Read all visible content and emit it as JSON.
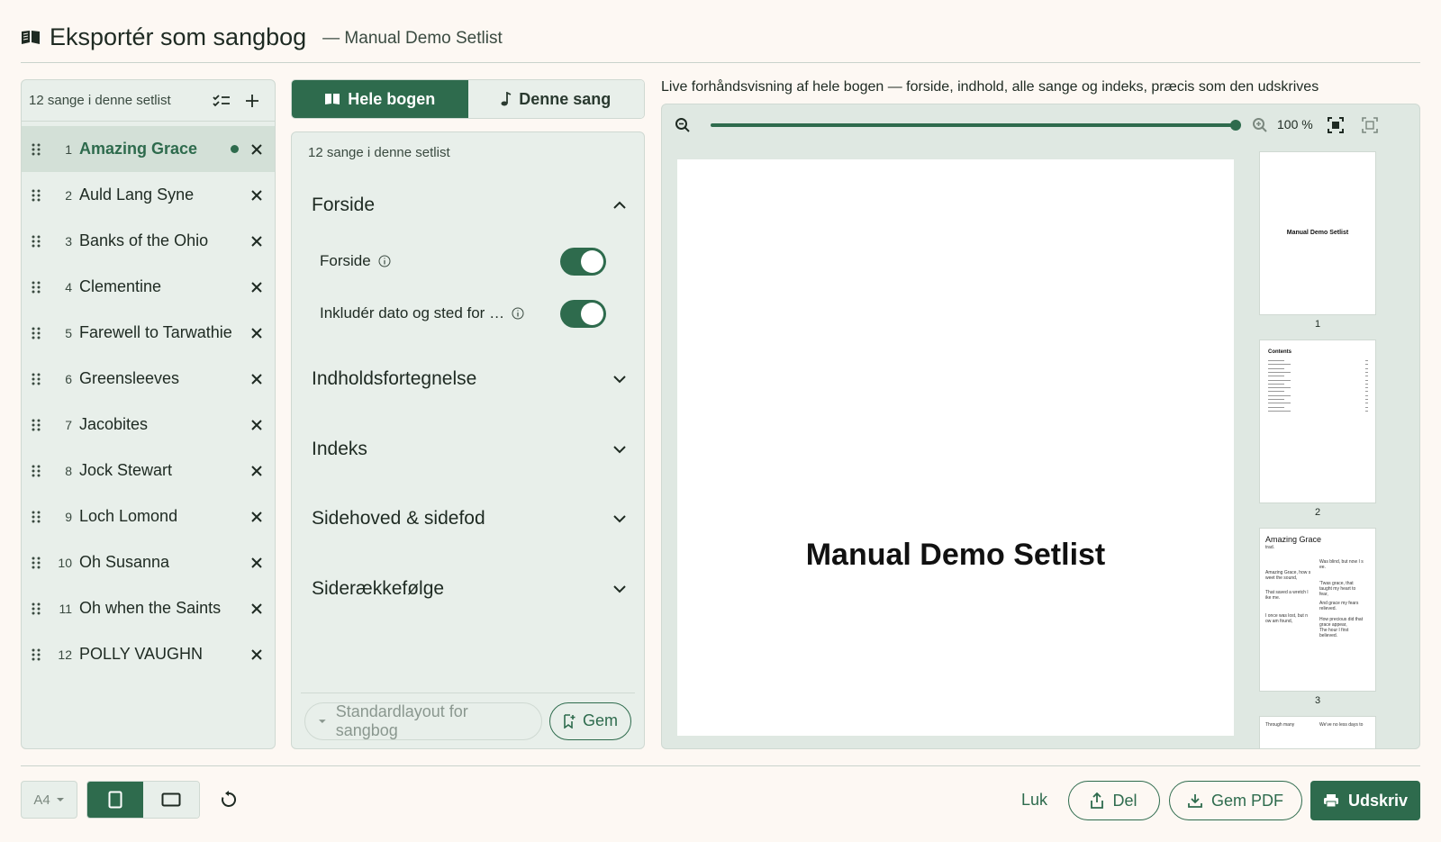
{
  "header": {
    "title": "Eksportér som sangbog",
    "subtitle": "— Manual Demo Setlist"
  },
  "left": {
    "count_label": "12 sange i denne setlist",
    "songs": [
      {
        "num": "1",
        "title": "Amazing Grace",
        "active": true
      },
      {
        "num": "2",
        "title": "Auld Lang Syne"
      },
      {
        "num": "3",
        "title": "Banks of the Ohio"
      },
      {
        "num": "4",
        "title": "Clementine"
      },
      {
        "num": "5",
        "title": "Farewell to Tarwathie"
      },
      {
        "num": "6",
        "title": "Greensleeves"
      },
      {
        "num": "7",
        "title": "Jacobites"
      },
      {
        "num": "8",
        "title": "Jock Stewart"
      },
      {
        "num": "9",
        "title": "Loch Lomond"
      },
      {
        "num": "10",
        "title": "Oh Susanna"
      },
      {
        "num": "11",
        "title": "Oh when the Saints"
      },
      {
        "num": "12",
        "title": "POLLY VAUGHN"
      }
    ]
  },
  "tabs": {
    "whole_book": "Hele bogen",
    "this_song": "Denne sang"
  },
  "middle": {
    "count_label": "12 sange i denne setlist",
    "sections": {
      "cover": "Forside",
      "toc": "Indholdsfortegnelse",
      "index": "Indeks",
      "header_footer": "Sidehoved & sidefod",
      "page_order": "Siderækkefølge"
    },
    "toggles": [
      {
        "label": "Forside",
        "on": true
      },
      {
        "label": "Inkludér dato og sted for …",
        "on": true
      }
    ],
    "layout_placeholder": "Standardlayout for sangbog",
    "save_label": "Gem"
  },
  "preview": {
    "caption": "Live forhåndsvisning af hele bogen — forside, indhold, alle sange og indeks, præcis som den udskrives",
    "zoom": "100 %",
    "zoom_value": 1.0,
    "cover_title": "Manual Demo Setlist",
    "thumbnails": [
      {
        "num": "1",
        "title": "Manual Demo Setlist"
      },
      {
        "num": "2",
        "title": "Contents"
      },
      {
        "num": "3",
        "title": "Amazing Grace",
        "sub": "trad.",
        "left_text": [
          "Amazing Grace, how s",
          "weet the sound,",
          "That saved a wretch l",
          "ike me.",
          "I once was lost, but n",
          "ow am found,"
        ],
        "right_text": [
          "Was blind, but now I s",
          "ee.",
          "'Twas grace, that",
          "taught my heart to",
          "fear,",
          "And grace my fears",
          "relieved.",
          "How precious did that",
          "grace appear,",
          "The hour I first",
          "believed."
        ]
      },
      {
        "left": "Through many",
        "right": "We've no less days to"
      }
    ]
  },
  "bottom": {
    "paper": "A4",
    "close": "Luk",
    "share": "Del",
    "save_pdf": "Gem PDF",
    "print": "Udskriv"
  },
  "colors": {
    "accent": "#2e6b4d",
    "panel": "#e8efea",
    "background": "#fdf8f3"
  }
}
